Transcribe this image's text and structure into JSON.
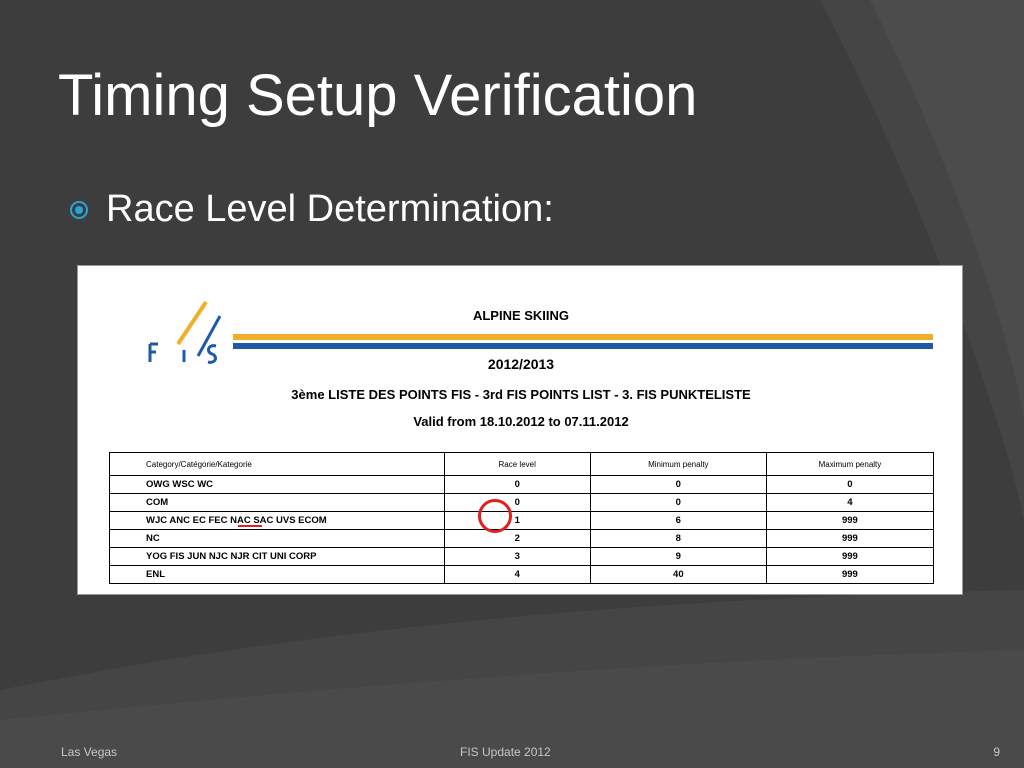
{
  "slide": {
    "title": "Timing Setup Verification",
    "bullet": "Race Level Determination:"
  },
  "document": {
    "logo_text": "F / I / S",
    "sport": "ALPINE SKIING",
    "season": "2012/2013",
    "list_title": "3ème LISTE DES POINTS FIS  -  3rd FIS POINTS LIST  -  3. FIS PUNKTELISTE",
    "valid": "Valid from 18.10.2012 to 07.11.2012",
    "table": {
      "headers": [
        "Category/Catégorie/Kategorie",
        "Race level",
        "Minimum penalty",
        "Maximum penalty"
      ],
      "rows": [
        [
          "OWG WSC WC",
          "0",
          "0",
          "0"
        ],
        [
          "COM",
          "0",
          "0",
          "4"
        ],
        [
          "WJC ANC EC FEC NAC SAC UVS ECOM",
          "1",
          "6",
          "999"
        ],
        [
          "NC",
          "2",
          "8",
          "999"
        ],
        [
          "YOG FIS JUN NJC NJR CIT UNI CORP",
          "3",
          "9",
          "999"
        ],
        [
          "ENL",
          "4",
          "40",
          "999"
        ]
      ]
    }
  },
  "footer": {
    "location": "Las Vegas",
    "event": "FIS Update 2012",
    "page_number": "9"
  },
  "colors": {
    "background": "#3a3a3a",
    "accent_blue": "#29a4d8",
    "highlight_red": "#e02020",
    "stripe_yellow": "#f2ad2b",
    "stripe_blue": "#1f5aa6"
  }
}
